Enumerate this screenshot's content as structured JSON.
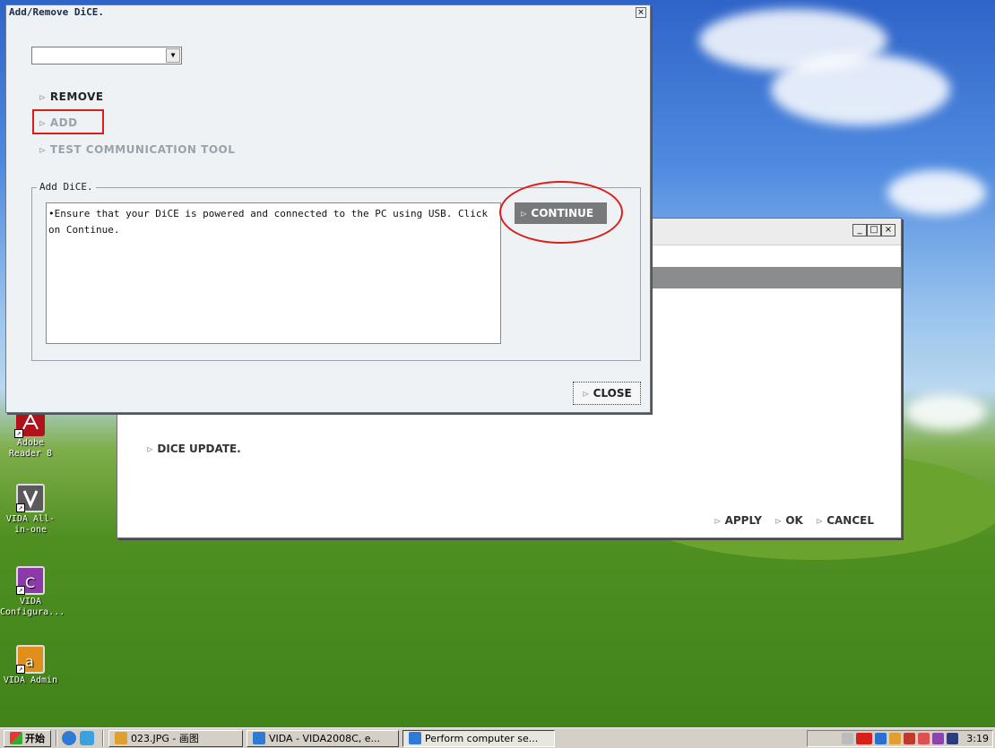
{
  "dialog": {
    "title": "Add/Remove DiCE.",
    "close_glyph": "×",
    "select_value": "",
    "select_arrow": "▼",
    "menu": {
      "remove": "REMOVE",
      "add": "ADD",
      "test": "TEST COMMUNICATION TOOL"
    },
    "group_label": "Add DiCE.",
    "message": "•Ensure that your DiCE is powered and connected to the PC using USB. Click on Continue.",
    "continue_label": "CONTINUE",
    "close_label": "CLOSE",
    "arrow_glyph": "⊳",
    "highlight_color": "#d8201b"
  },
  "background_window": {
    "caption_buttons": [
      "_",
      "□",
      "×"
    ],
    "dice_update_label": "DICE UPDATE.",
    "apply_label": "APPLY",
    "ok_label": "OK",
    "cancel_label": "CANCEL"
  },
  "desktop_icons": [
    {
      "label": "Adobe Reader 8",
      "icon": "adobe-reader-icon"
    },
    {
      "label": "VIDA All-in-one",
      "icon": "vida-all-in-one-icon"
    },
    {
      "label": "VIDA Configura...",
      "icon": "vida-configuration-icon"
    },
    {
      "label": "VIDA Admin",
      "icon": "vida-admin-icon"
    }
  ],
  "taskbar": {
    "start_label": "开始",
    "tasks": [
      {
        "label": "023.JPG - 画图",
        "icon": "paint-icon",
        "active": false
      },
      {
        "label": "VIDA - VIDA2008C, e...",
        "icon": "ie-icon",
        "active": false
      },
      {
        "label": "Perform computer se...",
        "icon": "ie-icon",
        "active": true
      }
    ],
    "clock": "3:19"
  }
}
